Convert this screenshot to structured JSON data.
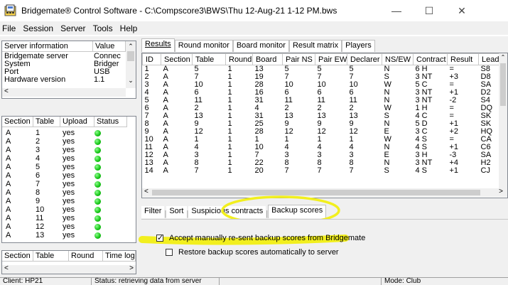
{
  "window": {
    "title": "Bridgemate® Control Software - C:\\Compscore3\\BWS\\Thu 12-Aug-21 1-12 PM.bws",
    "minimize_glyph": "—",
    "maximize_glyph": "☐",
    "close_glyph": "✕"
  },
  "menu": [
    "File",
    "Session",
    "Server",
    "Tools",
    "Help"
  ],
  "server_info": {
    "headers": [
      "Server information",
      "Value"
    ],
    "rows": [
      [
        "Bridgemate server",
        "Connec"
      ],
      [
        "System",
        "Bridger"
      ],
      [
        "Port",
        "USB"
      ],
      [
        "Hardware version",
        "1.1"
      ]
    ]
  },
  "tables_panel": {
    "headers": [
      "Section",
      "Table",
      "Upload",
      "Status"
    ],
    "rows": [
      [
        "A",
        "1",
        "yes"
      ],
      [
        "A",
        "2",
        "yes"
      ],
      [
        "A",
        "3",
        "yes"
      ],
      [
        "A",
        "4",
        "yes"
      ],
      [
        "A",
        "5",
        "yes"
      ],
      [
        "A",
        "6",
        "yes"
      ],
      [
        "A",
        "7",
        "yes"
      ],
      [
        "A",
        "8",
        "yes"
      ],
      [
        "A",
        "9",
        "yes"
      ],
      [
        "A",
        "10",
        "yes"
      ],
      [
        "A",
        "11",
        "yes"
      ],
      [
        "A",
        "12",
        "yes"
      ],
      [
        "A",
        "13",
        "yes"
      ]
    ],
    "status_color": "#13c313"
  },
  "rounds_panel": {
    "headers": [
      "Section",
      "Table",
      "Round",
      "Time log"
    ]
  },
  "main_tabs": [
    "Results",
    "Round monitor",
    "Board monitor",
    "Result matrix",
    "Players"
  ],
  "results": {
    "headers": [
      "ID",
      "Section",
      "Table",
      "Round",
      "Board",
      "Pair NS",
      "Pair EW",
      "Declarer",
      "NS/EW",
      "Contract",
      "Result",
      "Lead"
    ],
    "rows": [
      [
        "1",
        "A",
        "5",
        "1",
        "13",
        "5",
        "5",
        "5",
        "N",
        "6 H",
        "=",
        "S8"
      ],
      [
        "2",
        "A",
        "7",
        "1",
        "19",
        "7",
        "7",
        "7",
        "S",
        "3 NT",
        "+3",
        "D8"
      ],
      [
        "3",
        "A",
        "10",
        "1",
        "28",
        "10",
        "10",
        "10",
        "W",
        "5 C",
        "=",
        "SA"
      ],
      [
        "4",
        "A",
        "6",
        "1",
        "16",
        "6",
        "6",
        "6",
        "N",
        "3 NT",
        "+1",
        "D2"
      ],
      [
        "5",
        "A",
        "11",
        "1",
        "31",
        "11",
        "11",
        "11",
        "N",
        "3 NT",
        "-2",
        "S4"
      ],
      [
        "6",
        "A",
        "2",
        "1",
        "4",
        "2",
        "2",
        "2",
        "W",
        "1 H",
        "=",
        "DQ"
      ],
      [
        "7",
        "A",
        "13",
        "1",
        "31",
        "13",
        "13",
        "13",
        "S",
        "4 C",
        "=",
        "SK"
      ],
      [
        "8",
        "A",
        "9",
        "1",
        "25",
        "9",
        "9",
        "9",
        "N",
        "5 D",
        "+1",
        "SK"
      ],
      [
        "9",
        "A",
        "12",
        "1",
        "28",
        "12",
        "12",
        "12",
        "E",
        "3 C",
        "+2",
        "HQ"
      ],
      [
        "10",
        "A",
        "1",
        "1",
        "1",
        "1",
        "1",
        "1",
        "W",
        "4 S",
        "=",
        "CA"
      ],
      [
        "11",
        "A",
        "4",
        "1",
        "10",
        "4",
        "4",
        "4",
        "N",
        "4 S",
        "+1",
        "C6"
      ],
      [
        "12",
        "A",
        "3",
        "1",
        "7",
        "3",
        "3",
        "3",
        "E",
        "3 H",
        "-3",
        "SA"
      ],
      [
        "13",
        "A",
        "8",
        "1",
        "22",
        "8",
        "8",
        "8",
        "N",
        "3 NT",
        "+4",
        "H2"
      ],
      [
        "14",
        "A",
        "7",
        "1",
        "20",
        "7",
        "7",
        "7",
        "S",
        "4 S",
        "+1",
        "CJ"
      ]
    ]
  },
  "sub_tabs": [
    "Filter",
    "Sort",
    "Suspicious contracts",
    "Backup scores"
  ],
  "backup": {
    "accept_label": "Accept manually re-sent backup scores from Bridgemate",
    "accept_checked": true,
    "restore_label": "Restore backup scores automatically to server",
    "restore_checked": false,
    "highlight_color": "#f5f53a"
  },
  "status_bar": {
    "client": "Client: HP21",
    "status": "Status: retrieving data from server",
    "mode": "Mode: Club"
  }
}
